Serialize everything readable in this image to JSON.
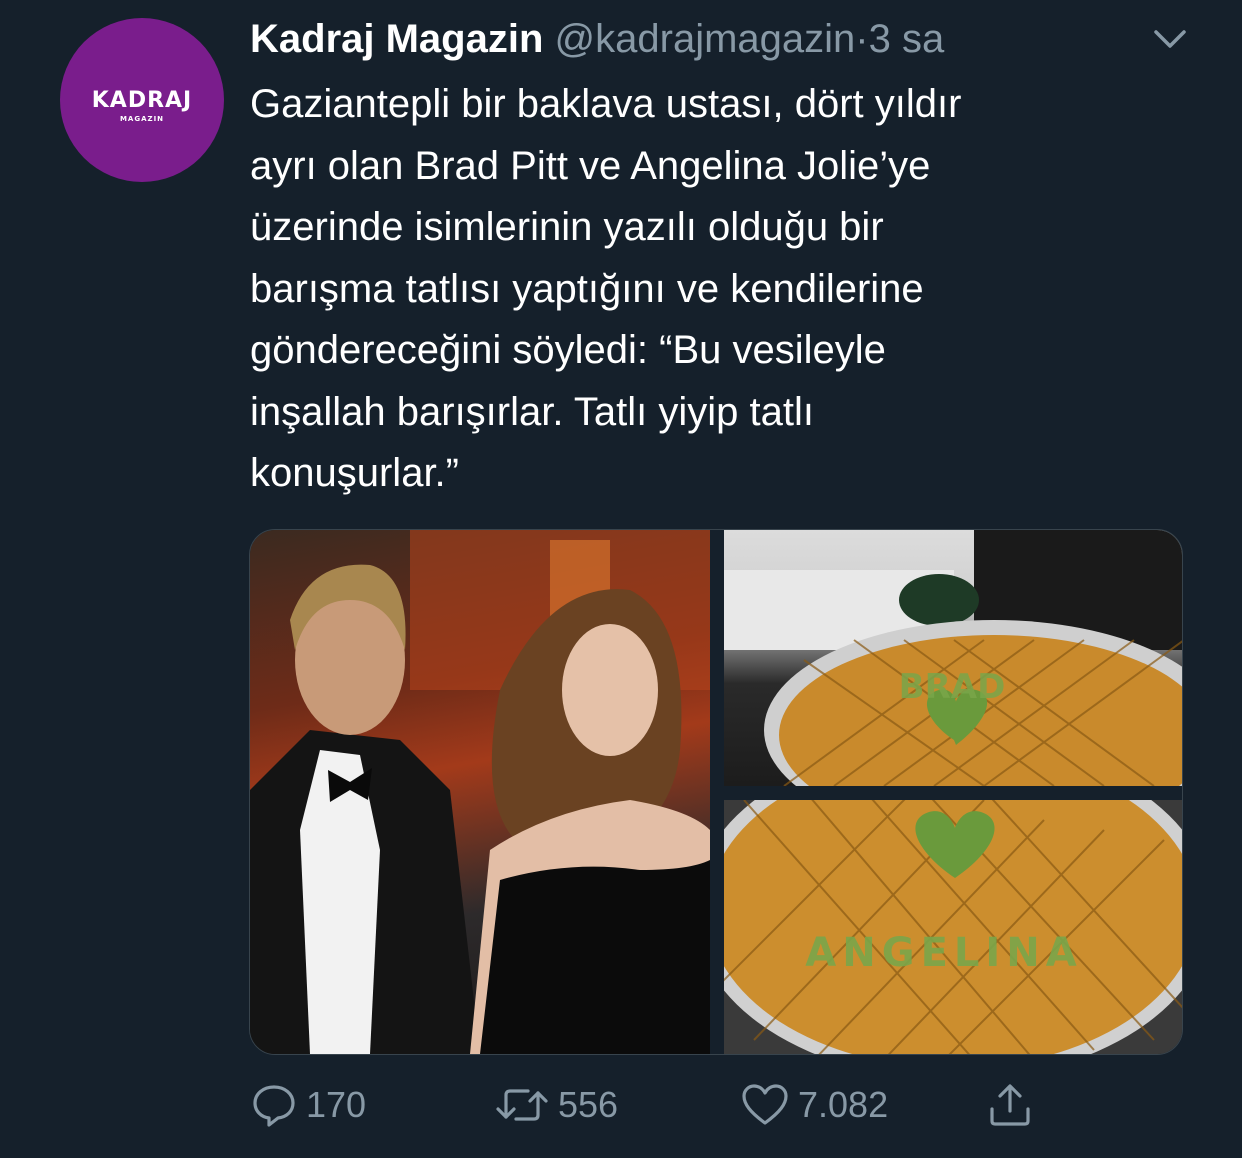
{
  "tweet": {
    "avatar": {
      "logo_main": "KADRAJ",
      "logo_sub": "MAGAZIN",
      "bg_color": "#7a1d8c"
    },
    "display_name": "Kadraj Magazin",
    "handle": "@kadrajmagazin",
    "separator": "·",
    "time": "3 sa",
    "text": "Gaziantepli bir baklava ustası, dört yıldır\nayrı olan Brad Pitt ve Angelina Jolie’ye\nüzerinde isimlerinin yazılı olduğu bir\nbarışma tatlısı yaptığını ve kendilerine\ngöndereceğini söyledi: “Bu vesileyle\ninşallah barışırlar. Tatlı yiyip tatlı\nkonuşurlar.”",
    "media": {
      "photo_top_name": "BRAD",
      "photo_bottom_name": "ANGELINA"
    },
    "actions": {
      "reply_count": "170",
      "retweet_count": "556",
      "like_count": "7.082"
    },
    "icons": {
      "reply": "reply-icon",
      "retweet": "retweet-icon",
      "like": "heart-icon",
      "share": "share-icon",
      "menu": "chevron-down-icon"
    },
    "colors": {
      "background": "#15202b",
      "secondary_text": "#8899a6",
      "primary_text": "#ffffff"
    }
  }
}
